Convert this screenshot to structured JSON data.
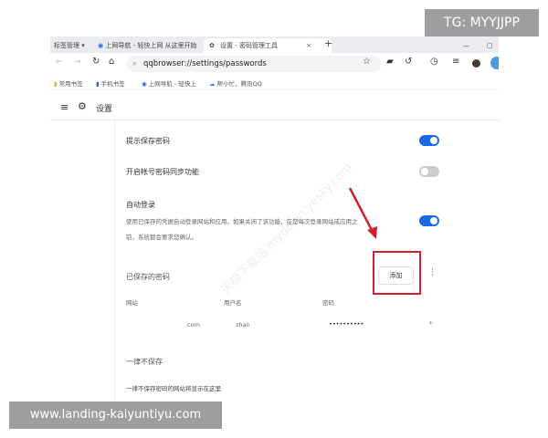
{
  "browser": {
    "tabs": [
      {
        "label": "标签管理 ▾",
        "icon": "tab-manager-icon"
      },
      {
        "label": "上网导航 - 轻快上网 从这里开始",
        "icon": "qq-browser-icon"
      },
      {
        "label": "设置 - 密码管理工具",
        "icon": "gear-icon",
        "active": true
      }
    ],
    "close_tab": "×",
    "new_tab": "+",
    "url": "qqbrowser://settings/passwords",
    "bookmarks": [
      "常用书签",
      "手机书签",
      "上网导航 - 轻快上",
      "帮小忙，腾讯QQ"
    ]
  },
  "settings": {
    "title": "设置",
    "offer_save": {
      "label": "提示保存密码",
      "enabled": true
    },
    "sync": {
      "label": "开启帐号密码同步功能",
      "enabled": false
    },
    "auto_login": {
      "label": "自动登录",
      "desc1": "使用已保存的凭据自动登录网站和应用。如果关闭了该功能，在您每次登录网站或应用之",
      "desc2": "前，系统都会要求您确认。",
      "enabled": true
    },
    "saved": {
      "title": "已保存的密码",
      "add": "添加",
      "more": "⋮",
      "headers": [
        "网站",
        "用户名",
        "密码"
      ],
      "rows": [
        {
          "site": ".com",
          "user": "zhan",
          "password": "••••••••••",
          "chevron": "›"
        }
      ]
    },
    "never": {
      "title": "一律不保存",
      "desc": "一律不保存密码的网站将显示在这里"
    }
  },
  "overlays": {
    "top": "TG: MYYJJPP",
    "bottom": "www.landing-kaiyuntiyu.com"
  },
  "watermark": "天极下载站 mydown.yesky.com",
  "colors": {
    "accent": "#1a6ae6",
    "highlight": "#d0202a"
  }
}
